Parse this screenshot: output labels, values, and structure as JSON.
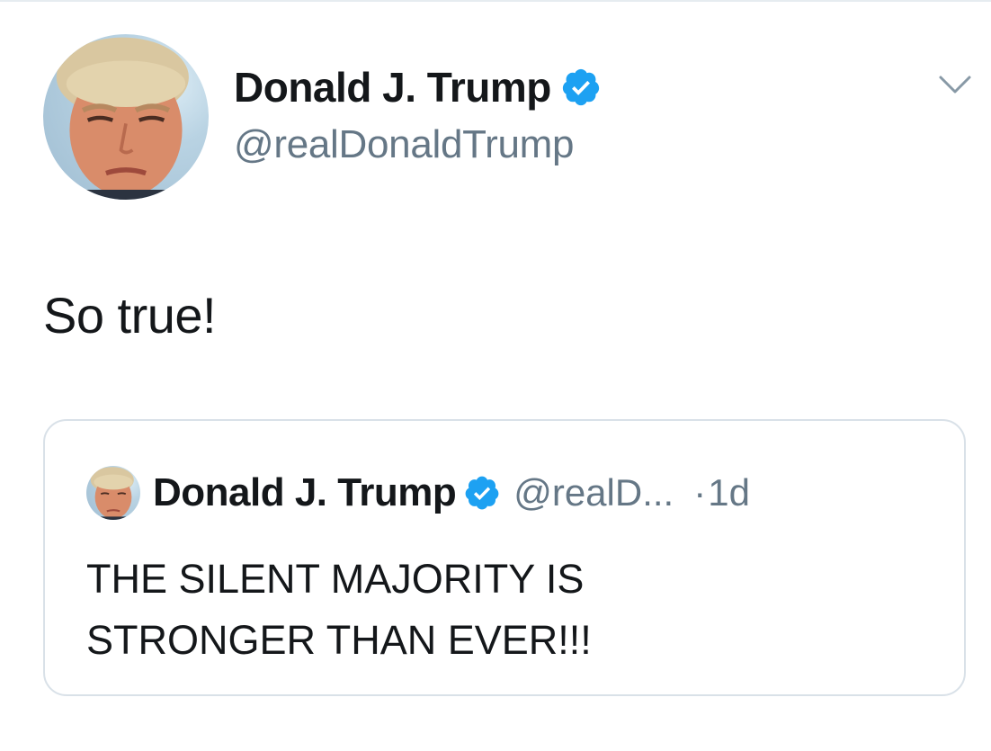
{
  "tweet": {
    "author": {
      "display_name": "Donald J. Trump",
      "handle": "@realDonaldTrump",
      "verified": true,
      "avatar_icon": "profile-photo"
    },
    "text": "So true!",
    "menu_icon": "chevron-down-icon"
  },
  "quoted_tweet": {
    "author": {
      "display_name": "Donald J. Trump",
      "handle": "@realD...",
      "verified": true,
      "avatar_icon": "profile-photo"
    },
    "separator": "·",
    "time": "1d",
    "text_lines": [
      "THE SILENT MAJORITY IS",
      "STRONGER THAN EVER!!!"
    ]
  },
  "colors": {
    "text_primary": "#14171a",
    "text_secondary": "#657786",
    "verified_blue": "#1da1f2",
    "border": "#d9e1e8"
  }
}
